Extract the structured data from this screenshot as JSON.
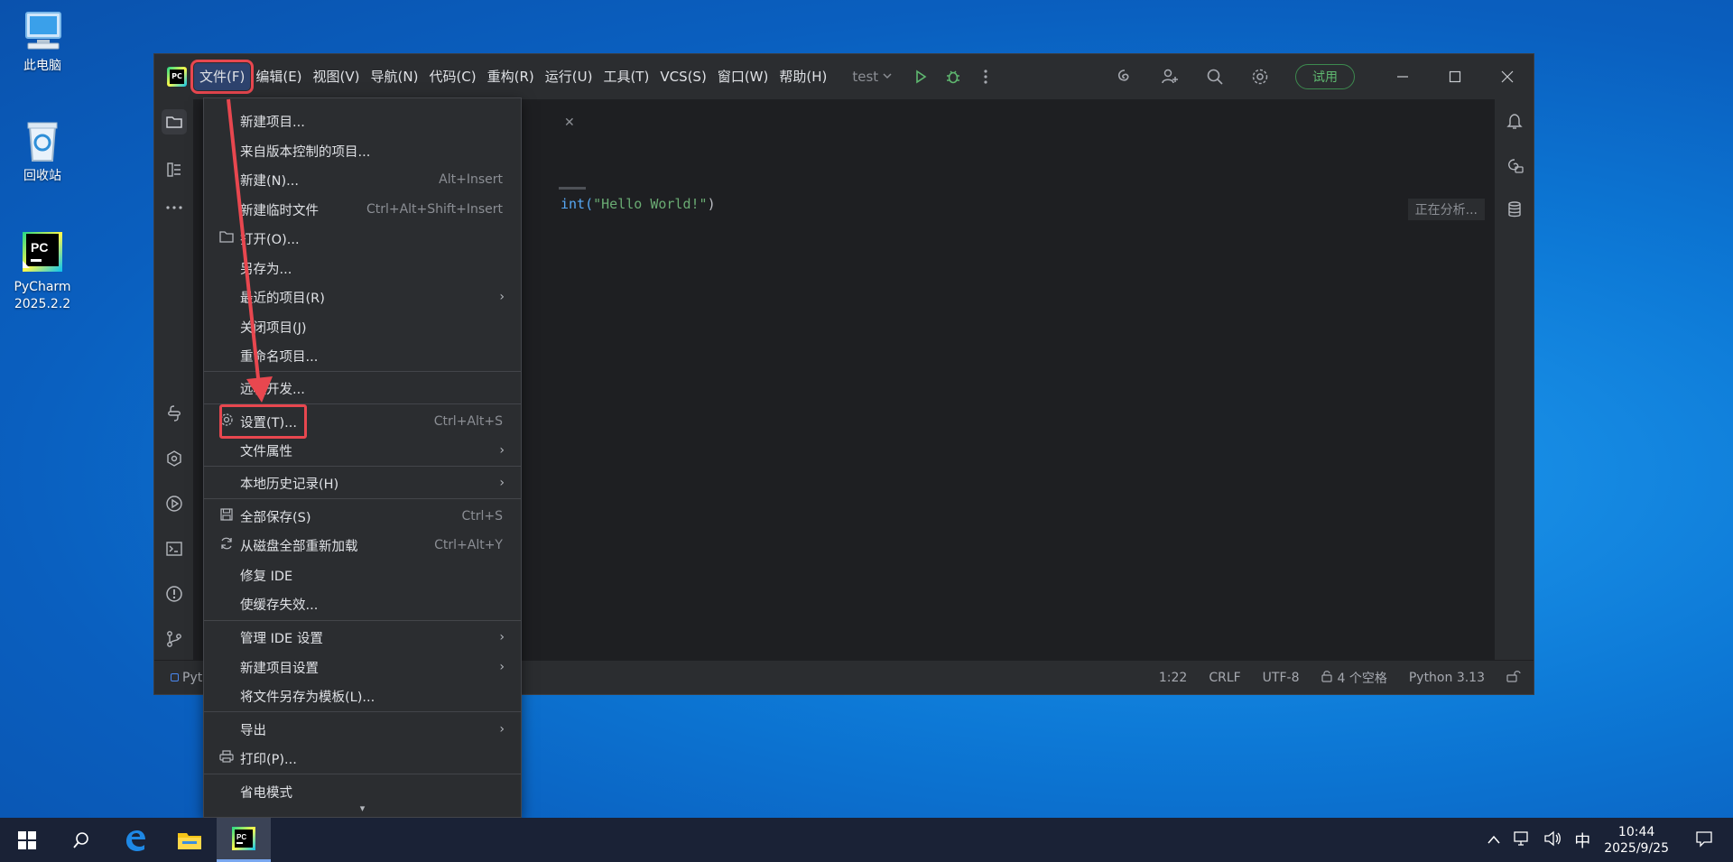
{
  "desktop": {
    "icons": [
      {
        "label": "此电脑"
      },
      {
        "label": "回收站"
      },
      {
        "label": "PyCharm\n2025.2.2",
        "line1": "PyCharm",
        "line2": "2025.2.2"
      }
    ]
  },
  "menubar": {
    "items": [
      "文件(F)",
      "编辑(E)",
      "视图(V)",
      "导航(N)",
      "代码(C)",
      "重构(R)",
      "运行(U)",
      "工具(T)",
      "VCS(S)",
      "窗口(W)",
      "帮助(H)"
    ],
    "run_config": "test",
    "trial_label": "试用"
  },
  "editor": {
    "code_prefix": "int(",
    "code_string": "\"Hello World!\"",
    "code_suffix": ")",
    "analyzing": "正在分析..."
  },
  "statusbar": {
    "project_stub": "Pyt",
    "position": "1:22",
    "line_sep": "CRLF",
    "encoding": "UTF-8",
    "indent": "4 个空格",
    "interpreter": "Python 3.13"
  },
  "file_menu": {
    "items": [
      {
        "label": "新建项目...",
        "shortcut": "",
        "icon": "",
        "submenu": false
      },
      {
        "label": "来自版本控制的项目...",
        "shortcut": "",
        "icon": "",
        "submenu": false
      },
      {
        "label": "新建(N)...",
        "shortcut": "Alt+Insert",
        "icon": "",
        "submenu": false
      },
      {
        "label": "新建临时文件",
        "shortcut": "Ctrl+Alt+Shift+Insert",
        "icon": "",
        "submenu": false
      },
      {
        "label": "打开(O)...",
        "shortcut": "",
        "icon": "folder-icon",
        "submenu": false
      },
      {
        "label": "另存为...",
        "shortcut": "",
        "icon": "",
        "submenu": false
      },
      {
        "label": "最近的项目(R)",
        "shortcut": "",
        "icon": "",
        "submenu": true
      },
      {
        "label": "关闭项目(J)",
        "shortcut": "",
        "icon": "",
        "submenu": false
      },
      {
        "label": "重命名项目...",
        "shortcut": "",
        "icon": "",
        "submenu": false
      },
      {
        "label": "远程开发...",
        "shortcut": "",
        "icon": "",
        "submenu": false
      },
      {
        "label": "设置(T)...",
        "shortcut": "Ctrl+Alt+S",
        "icon": "gear-icon",
        "submenu": false
      },
      {
        "label": "文件属性",
        "shortcut": "",
        "icon": "",
        "submenu": true
      },
      {
        "label": "本地历史记录(H)",
        "shortcut": "",
        "icon": "",
        "submenu": true
      },
      {
        "label": "全部保存(S)",
        "shortcut": "Ctrl+S",
        "icon": "save-icon",
        "submenu": false
      },
      {
        "label": "从磁盘全部重新加载",
        "shortcut": "Ctrl+Alt+Y",
        "icon": "reload-icon",
        "submenu": false
      },
      {
        "label": "修复 IDE",
        "shortcut": "",
        "icon": "",
        "submenu": false
      },
      {
        "label": "使缓存失效...",
        "shortcut": "",
        "icon": "",
        "submenu": false
      },
      {
        "label": "管理 IDE 设置",
        "shortcut": "",
        "icon": "",
        "submenu": true
      },
      {
        "label": "新建项目设置",
        "shortcut": "",
        "icon": "",
        "submenu": true
      },
      {
        "label": "将文件另存为模板(L)...",
        "shortcut": "",
        "icon": "",
        "submenu": false
      },
      {
        "label": "导出",
        "shortcut": "",
        "icon": "",
        "submenu": true
      },
      {
        "label": "打印(P)...",
        "shortcut": "",
        "icon": "print-icon",
        "submenu": false
      },
      {
        "label": "省电模式",
        "shortcut": "",
        "icon": "",
        "submenu": false
      }
    ]
  },
  "taskbar": {
    "ime": "中",
    "time": "10:44",
    "date": "2025/9/25"
  },
  "colors": {
    "highlight": "#e8474f",
    "ide_bg": "#1e1f22",
    "panel_bg": "#2b2d30",
    "accent_green": "#5fb870"
  }
}
